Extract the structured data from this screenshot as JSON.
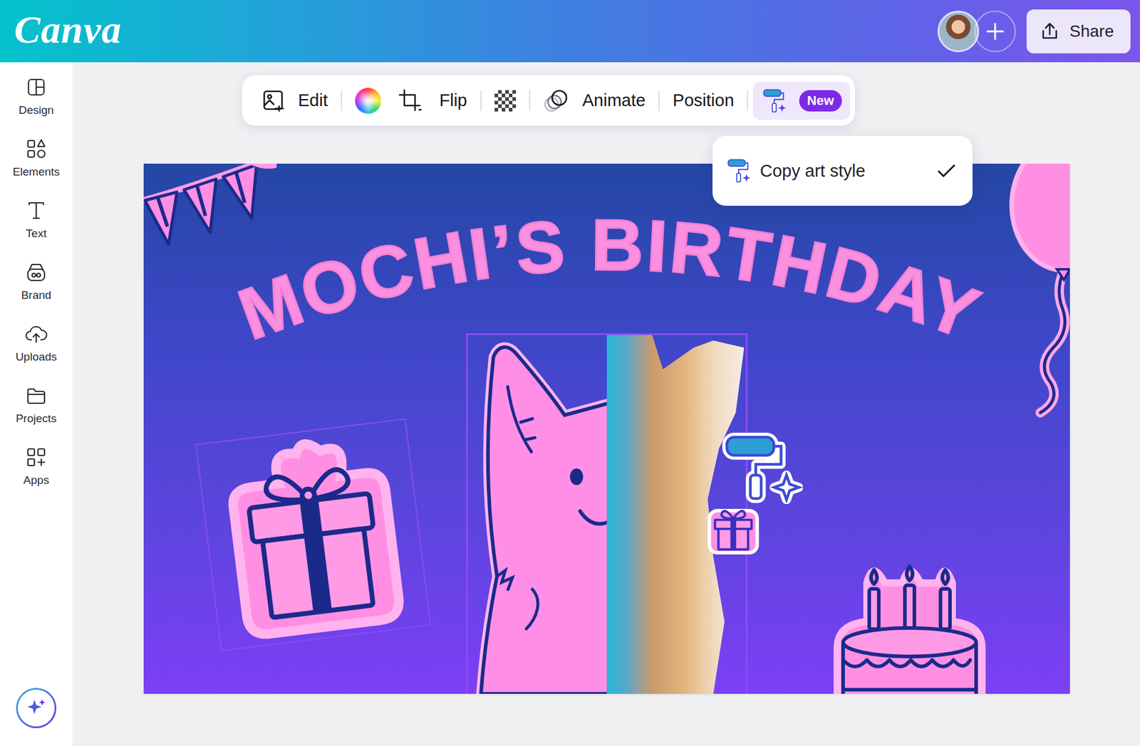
{
  "topbar": {
    "logo": "Canva",
    "share": "Share"
  },
  "sidebar": {
    "items": [
      {
        "label": "Design"
      },
      {
        "label": "Elements"
      },
      {
        "label": "Text"
      },
      {
        "label": "Brand"
      },
      {
        "label": "Uploads"
      },
      {
        "label": "Projects"
      },
      {
        "label": "Apps"
      }
    ]
  },
  "toolbar": {
    "items": [
      {
        "kind": "edit",
        "label": "Edit",
        "selected": false
      },
      {
        "kind": "color",
        "selected": false
      },
      {
        "kind": "crop",
        "selected": false
      },
      {
        "kind": "flip",
        "label": "Flip",
        "selected": false
      },
      {
        "kind": "transparency",
        "selected": false
      },
      {
        "kind": "animate",
        "label": "Animate",
        "selected": false
      },
      {
        "kind": "position",
        "label": "Position",
        "selected": false
      },
      {
        "kind": "artstyle",
        "badge": "New",
        "selected": true
      }
    ]
  },
  "menu": {
    "items": [
      {
        "label": "Copy art style",
        "checked": true
      }
    ]
  },
  "canvas": {
    "title": "MOCHI’S BIRTHDAY"
  }
}
